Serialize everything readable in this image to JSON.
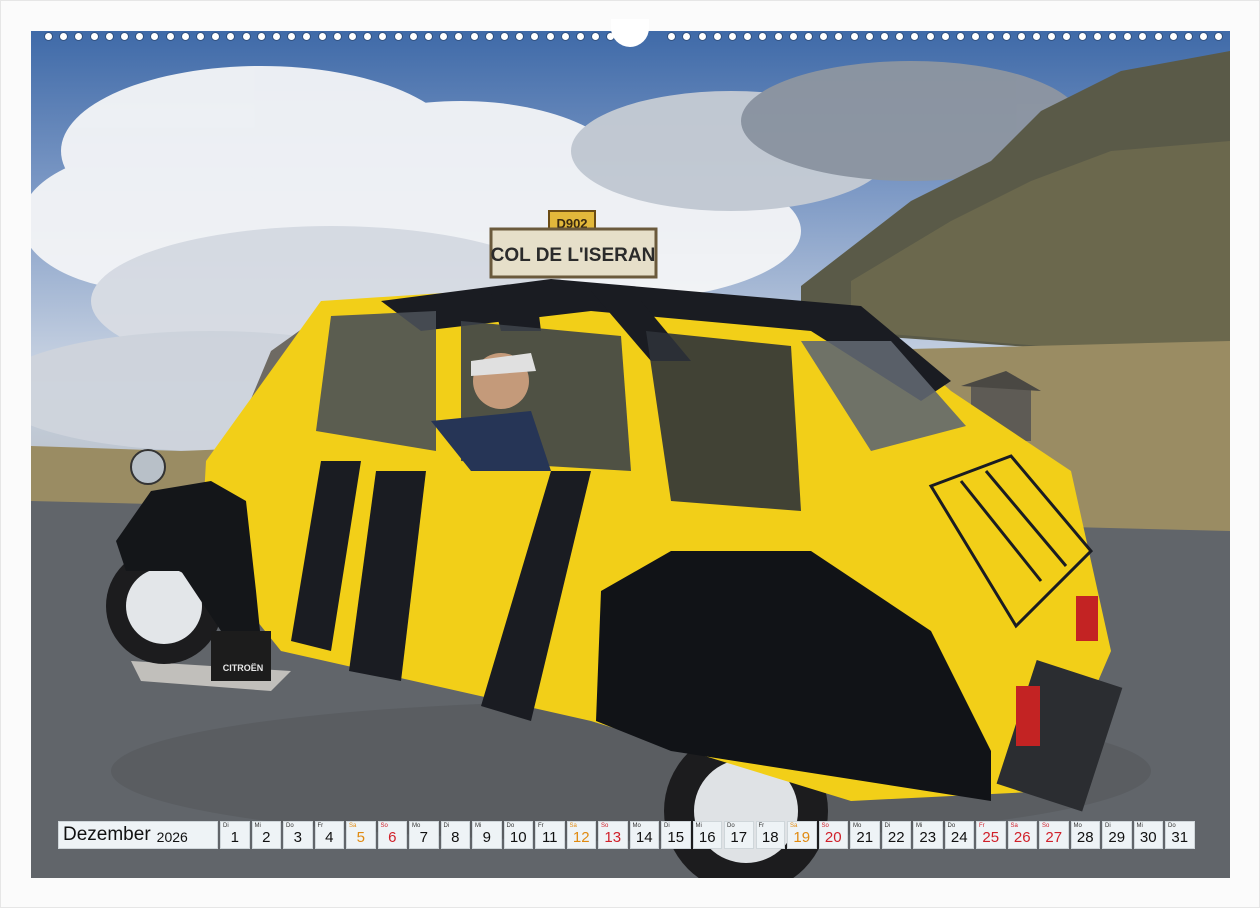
{
  "calendar": {
    "month": "Dezember",
    "year": "2026",
    "days": [
      {
        "wd": "Di",
        "num": "1",
        "type": "weekday"
      },
      {
        "wd": "Mi",
        "num": "2",
        "type": "weekday"
      },
      {
        "wd": "Do",
        "num": "3",
        "type": "weekday"
      },
      {
        "wd": "Fr",
        "num": "4",
        "type": "weekday"
      },
      {
        "wd": "Sa",
        "num": "5",
        "type": "sat"
      },
      {
        "wd": "So",
        "num": "6",
        "type": "sun"
      },
      {
        "wd": "Mo",
        "num": "7",
        "type": "weekday"
      },
      {
        "wd": "Di",
        "num": "8",
        "type": "weekday"
      },
      {
        "wd": "Mi",
        "num": "9",
        "type": "weekday"
      },
      {
        "wd": "Do",
        "num": "10",
        "type": "weekday"
      },
      {
        "wd": "Fr",
        "num": "11",
        "type": "weekday"
      },
      {
        "wd": "Sa",
        "num": "12",
        "type": "sat"
      },
      {
        "wd": "So",
        "num": "13",
        "type": "sun"
      },
      {
        "wd": "Mo",
        "num": "14",
        "type": "weekday"
      },
      {
        "wd": "Di",
        "num": "15",
        "type": "weekday"
      },
      {
        "wd": "Mi",
        "num": "16",
        "type": "weekday"
      },
      {
        "wd": "Do",
        "num": "17",
        "type": "weekday"
      },
      {
        "wd": "Fr",
        "num": "18",
        "type": "weekday"
      },
      {
        "wd": "Sa",
        "num": "19",
        "type": "sat"
      },
      {
        "wd": "So",
        "num": "20",
        "type": "sun"
      },
      {
        "wd": "Mo",
        "num": "21",
        "type": "weekday"
      },
      {
        "wd": "Di",
        "num": "22",
        "type": "weekday"
      },
      {
        "wd": "Mi",
        "num": "23",
        "type": "weekday"
      },
      {
        "wd": "Do",
        "num": "24",
        "type": "weekday"
      },
      {
        "wd": "Fr",
        "num": "25",
        "type": "sun"
      },
      {
        "wd": "Sa",
        "num": "26",
        "type": "sun"
      },
      {
        "wd": "So",
        "num": "27",
        "type": "sun"
      },
      {
        "wd": "Mo",
        "num": "28",
        "type": "weekday"
      },
      {
        "wd": "Di",
        "num": "29",
        "type": "weekday"
      },
      {
        "wd": "Mi",
        "num": "30",
        "type": "weekday"
      },
      {
        "wd": "Do",
        "num": "31",
        "type": "weekday"
      }
    ]
  },
  "photo": {
    "road_number": "D902",
    "sign_text": "COL DE L'ISERAN",
    "mudflap_text": "CITROËN",
    "colors": {
      "car_yellow": "#f2cf18",
      "car_black": "#1a1c22",
      "sky_blue": "#3f6aa8",
      "road_gray": "#5d6167",
      "sunday_red": "#d0202a",
      "saturday_orange": "#e08a10"
    }
  }
}
